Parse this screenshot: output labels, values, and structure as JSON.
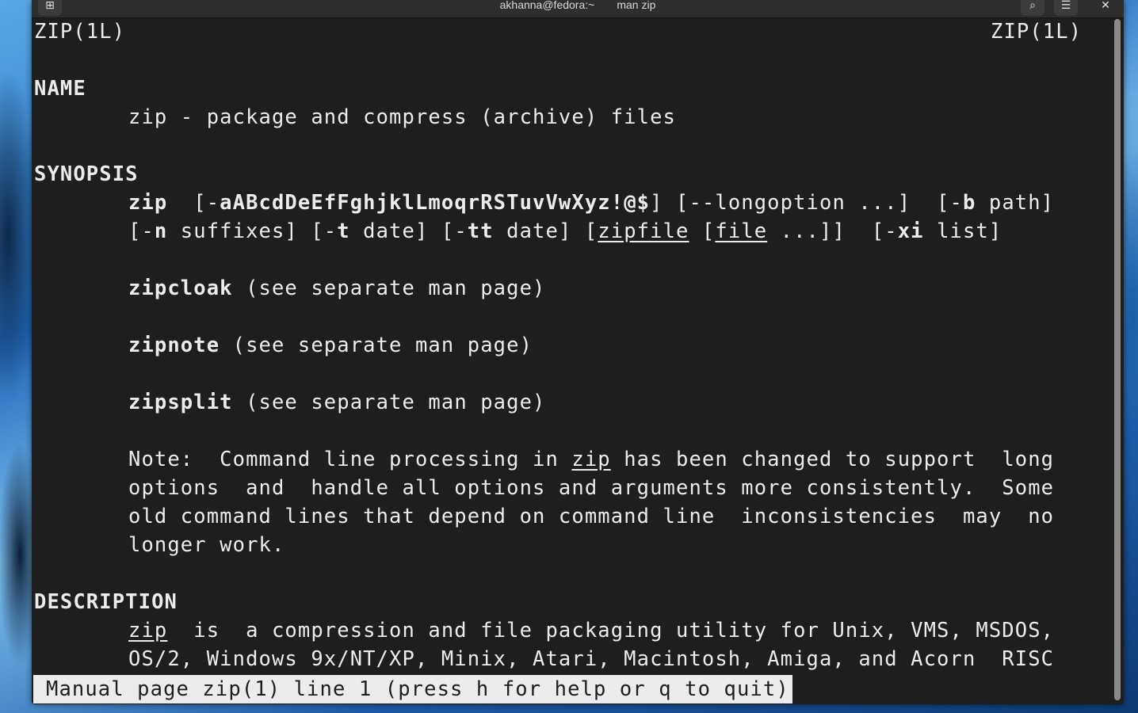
{
  "window": {
    "title_left": "akhanna@fedora:~",
    "title_right": "man zip"
  },
  "man": {
    "header_left": "ZIP(1L)",
    "header_right": "ZIP(1L)",
    "name_heading": "NAME",
    "name_text": "zip - package and compress (archive) files",
    "synopsis_heading": "SYNOPSIS",
    "syn1_cmd": "zip",
    "syn1_open": "[-",
    "syn1_opts": "aABcdDeEfFghjklLmoqrRSTuvVwXyz!@$",
    "syn1_mid": "] [--longoption ...]  [-",
    "syn1_b": "b",
    "syn1_end": " path]",
    "syn2_a": "[-",
    "syn2_n": "n",
    "syn2_b": " suffixes] [-",
    "syn2_t": "t",
    "syn2_c": " date] [-",
    "syn2_tt": "tt",
    "syn2_d": " date] [",
    "syn2_zipfile": "zipfile",
    "syn2_e": " [",
    "syn2_file": "file",
    "syn2_f": " ...]]  [-",
    "syn2_xi": "xi",
    "syn2_g": " list]",
    "zipcloak_cmd": "zipcloak",
    "zipnote_cmd": "zipnote",
    "zipsplit_cmd": "zipsplit",
    "see_separate": " (see separate man page)",
    "note_a": "Note:  Command line processing in ",
    "note_zip": "zip",
    "note_b": " has been changed to support  long",
    "note_l2": "options  and  handle all options and arguments more consistently.  Some",
    "note_l3": "old command lines that depend on command line  inconsistencies  may  no",
    "note_l4": "longer work.",
    "description_heading": "DESCRIPTION",
    "desc_zip": "zip",
    "desc_l1": "  is  a compression and file packaging utility for Unix, VMS, MSDOS,",
    "desc_l2": "OS/2, Windows 9x/NT/XP, Minix, Atari, Macintosh, Amiga, and Acorn  RISC"
  },
  "status_bar": "Manual page zip(1) line 1 (press h for help or q to quit)"
}
